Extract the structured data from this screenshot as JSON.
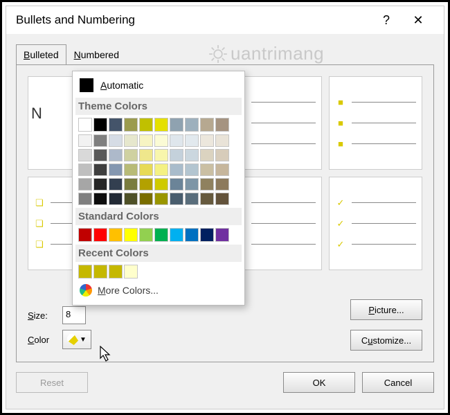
{
  "titlebar": {
    "title": "Bullets and Numbering",
    "help_symbol": "?",
    "close_symbol": "✕"
  },
  "tabs": {
    "bulleted": "Bulleted",
    "numbered": "Numbered"
  },
  "preview": {
    "none_label": "N"
  },
  "controls": {
    "size_label": "Size:",
    "size_value": "8",
    "color_label": "Color"
  },
  "side_buttons": {
    "picture": "Picture...",
    "customize": "Customize..."
  },
  "footer": {
    "reset": "Reset",
    "ok": "OK",
    "cancel": "Cancel"
  },
  "color_picker": {
    "automatic_label": "Automatic",
    "theme_heading": "Theme Colors",
    "theme_row1": [
      "#ffffff",
      "#000000",
      "#44546a",
      "#9b9b4e",
      "#c0c000",
      "#e5e000",
      "#8fa2b0",
      "#9db0bd",
      "#b6a890",
      "#a59380"
    ],
    "theme_tints": [
      [
        "#f2f2f2",
        "#7f7f7f",
        "#d6dce5",
        "#e6e7cd",
        "#f7f4c3",
        "#fbfbd5",
        "#dfe6ec",
        "#e2e9ee",
        "#ece7dd",
        "#e9e3d8"
      ],
      [
        "#d9d9d9",
        "#595959",
        "#adb9ca",
        "#cfd1a1",
        "#efe78c",
        "#f8f6ac",
        "#c4d1db",
        "#cbd7df",
        "#dbd3c0",
        "#d7ccba"
      ],
      [
        "#bfbfbf",
        "#3f3f3f",
        "#8497b0",
        "#b8bb77",
        "#e7da56",
        "#f4f183",
        "#a9bccb",
        "#b3c5d0",
        "#cabfa3",
        "#c6b69c"
      ],
      [
        "#a6a6a6",
        "#262626",
        "#333f50",
        "#7a7c3e",
        "#b3a100",
        "#cfca00",
        "#6b8498",
        "#7d95a6",
        "#8f815f",
        "#8c7a5c"
      ],
      [
        "#7f7f7f",
        "#0d0d0d",
        "#222a35",
        "#4f5128",
        "#7a6e00",
        "#9a9600",
        "#4a5e6e",
        "#5a6e7c",
        "#665a3e",
        "#63533b"
      ]
    ],
    "standard_heading": "Standard Colors",
    "standard": [
      "#c00000",
      "#ff0000",
      "#ffc000",
      "#ffff00",
      "#92d050",
      "#00b050",
      "#00b0f0",
      "#0070c0",
      "#002060",
      "#7030a0"
    ],
    "recent_heading": "Recent Colors",
    "recent": [
      "#c5b800",
      "#c5b800",
      "#c5b800",
      "#ffffcc"
    ],
    "more_label": "More Colors..."
  },
  "watermark": {
    "text": "uantrimang"
  }
}
